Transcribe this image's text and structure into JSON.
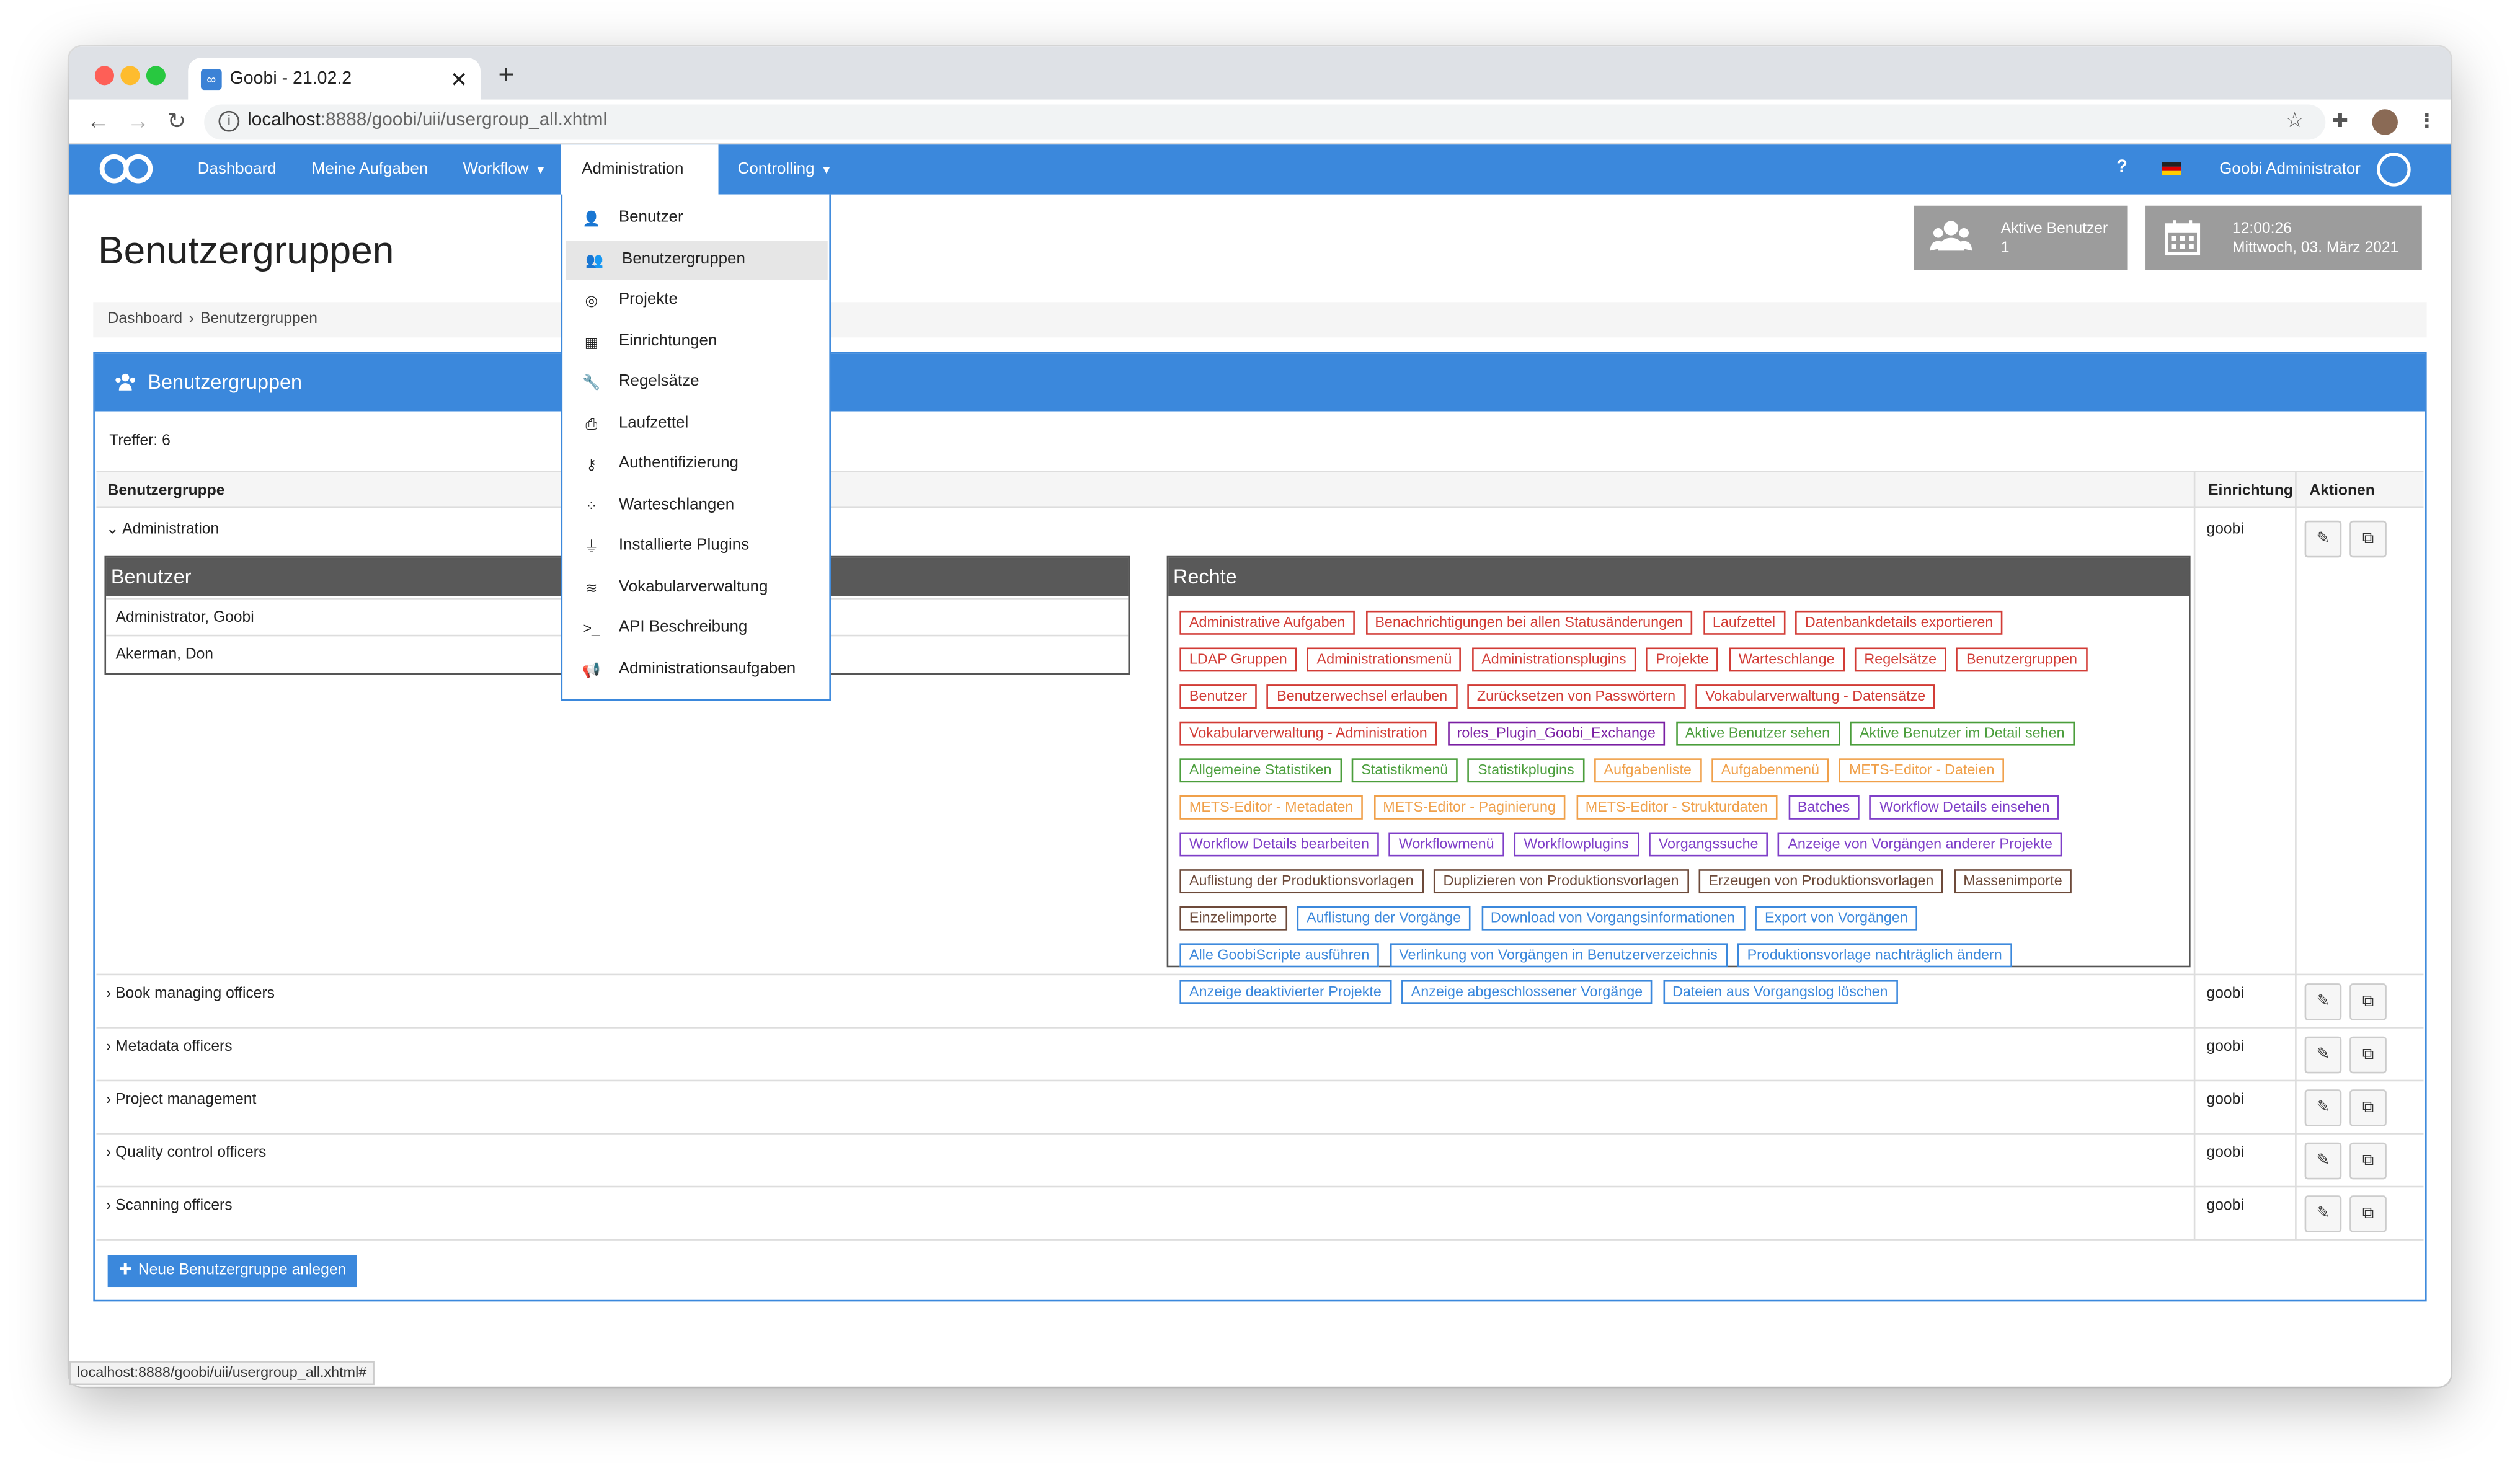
{
  "browser": {
    "tab_title": "Goobi - 21.02.2",
    "url_host": "localhost",
    "url_rest": ":8888/goobi/uii/usergroup_all.xhtml",
    "status_url": "localhost:8888/goobi/uii/usergroup_all.xhtml#"
  },
  "nav": {
    "dashboard": "Dashboard",
    "tasks": "Meine Aufgaben",
    "workflow": "Workflow",
    "administration": "Administration",
    "controlling": "Controlling",
    "help": "?",
    "user": "Goobi Administrator"
  },
  "admin_menu": [
    {
      "icon": "user-icon",
      "glyph": "👤",
      "label": "Benutzer"
    },
    {
      "icon": "users-icon",
      "glyph": "👥",
      "label": "Benutzergruppen"
    },
    {
      "icon": "projects-icon",
      "glyph": "◎",
      "label": "Projekte"
    },
    {
      "icon": "building-icon",
      "glyph": "▦",
      "label": "Einrichtungen"
    },
    {
      "icon": "wrench-icon",
      "glyph": "🔧",
      "label": "Regelsätze"
    },
    {
      "icon": "print-icon",
      "glyph": "⎙",
      "label": "Laufzettel"
    },
    {
      "icon": "key-icon",
      "glyph": "⚷",
      "label": "Authentifizierung"
    },
    {
      "icon": "spinner-icon",
      "glyph": "⁘",
      "label": "Warteschlangen"
    },
    {
      "icon": "plug-icon",
      "glyph": "⏚",
      "label": "Installierte Plugins"
    },
    {
      "icon": "database-icon",
      "glyph": "≋",
      "label": "Vokabularverwaltung"
    },
    {
      "icon": "terminal-icon",
      "glyph": ">_",
      "label": "API Beschreibung"
    },
    {
      "icon": "bullhorn-icon",
      "glyph": "📢",
      "label": "Administrationsaufgaben"
    }
  ],
  "page": {
    "title": "Benutzergruppen",
    "breadcrumb": [
      "Dashboard",
      "Benutzergruppen"
    ],
    "widgets": {
      "active_users_label": "Aktive Benutzer",
      "active_users_count": "1",
      "time": "12:00:26",
      "date": "Mittwoch, 03. März 2021"
    }
  },
  "panel": {
    "title": "Benutzergruppen",
    "hits": "Treffer: 6",
    "columns": [
      "Benutzergruppe",
      "Einrichtung",
      "Aktionen"
    ],
    "groups": [
      {
        "name": "Administration",
        "institution": "goobi"
      },
      {
        "name": "Book managing officers",
        "institution": "goobi"
      },
      {
        "name": "Metadata officers",
        "institution": "goobi"
      },
      {
        "name": "Project management",
        "institution": "goobi"
      },
      {
        "name": "Quality control officers",
        "institution": "goobi"
      },
      {
        "name": "Scanning officers",
        "institution": "goobi"
      }
    ],
    "users_box": {
      "title": "Benutzer",
      "users": [
        "Administrator, Goobi",
        "Akerman, Don"
      ]
    },
    "rights_box": {
      "title": "Rechte",
      "rights": [
        {
          "label": "Administrative Aufgaben",
          "color": "#d23c36"
        },
        {
          "label": "Benachrichtigungen bei allen Statusänderungen",
          "color": "#d23c36"
        },
        {
          "label": "Laufzettel",
          "color": "#d23c36"
        },
        {
          "label": "Datenbankdetails exportieren",
          "color": "#d23c36"
        },
        {
          "label": "LDAP Gruppen",
          "color": "#d23c36"
        },
        {
          "label": "Administrationsmenü",
          "color": "#d23c36"
        },
        {
          "label": "Administrationsplugins",
          "color": "#d23c36"
        },
        {
          "label": "Projekte",
          "color": "#d23c36"
        },
        {
          "label": "Warteschlange",
          "color": "#d23c36"
        },
        {
          "label": "Regelsätze",
          "color": "#d23c36"
        },
        {
          "label": "Benutzergruppen",
          "color": "#d23c36"
        },
        {
          "label": "Benutzer",
          "color": "#d23c36"
        },
        {
          "label": "Benutzerwechsel erlauben",
          "color": "#d23c36"
        },
        {
          "label": "Zurücksetzen von Passwörtern",
          "color": "#d23c36"
        },
        {
          "label": "Vokabularverwaltung - Datensätze",
          "color": "#d23c36"
        },
        {
          "label": "Vokabularverwaltung - Administration",
          "color": "#d23c36"
        },
        {
          "label": "roles_Plugin_Goobi_Exchange",
          "color": "#7a1fa3"
        },
        {
          "label": "Aktive Benutzer sehen",
          "color": "#4b9e3c"
        },
        {
          "label": "Aktive Benutzer im Detail sehen",
          "color": "#4b9e3c"
        },
        {
          "label": "Allgemeine Statistiken",
          "color": "#4b9e3c"
        },
        {
          "label": "Statistikmenü",
          "color": "#4b9e3c"
        },
        {
          "label": "Statistikplugins",
          "color": "#4b9e3c"
        },
        {
          "label": "Aufgabenliste",
          "color": "#f0a04a"
        },
        {
          "label": "Aufgabenmenü",
          "color": "#f0a04a"
        },
        {
          "label": "METS-Editor - Dateien",
          "color": "#f0a04a"
        },
        {
          "label": "METS-Editor - Metadaten",
          "color": "#f0a04a"
        },
        {
          "label": "METS-Editor - Paginierung",
          "color": "#f0a04a"
        },
        {
          "label": "METS-Editor - Strukturdaten",
          "color": "#f0a04a"
        },
        {
          "label": "Batches",
          "color": "#7f3fc8"
        },
        {
          "label": "Workflow Details einsehen",
          "color": "#7f3fc8"
        },
        {
          "label": "Workflow Details bearbeiten",
          "color": "#7f3fc8"
        },
        {
          "label": "Workflowmenü",
          "color": "#7f3fc8"
        },
        {
          "label": "Workflowplugins",
          "color": "#7f3fc8"
        },
        {
          "label": "Vorgangssuche",
          "color": "#7f3fc8"
        },
        {
          "label": "Anzeige von Vorgängen anderer Projekte",
          "color": "#7f3fc8"
        },
        {
          "label": "Auflistung der Produktionsvorlagen",
          "color": "#6d4a3a"
        },
        {
          "label": "Duplizieren von Produktionsvorlagen",
          "color": "#6d4a3a"
        },
        {
          "label": "Erzeugen von Produktionsvorlagen",
          "color": "#6d4a3a"
        },
        {
          "label": "Massenimporte",
          "color": "#6d4a3a"
        },
        {
          "label": "Einzelimporte",
          "color": "#6d4a3a"
        },
        {
          "label": "Auflistung der Vorgänge",
          "color": "#3b88dc"
        },
        {
          "label": "Download von Vorgangsinformationen",
          "color": "#3b88dc"
        },
        {
          "label": "Export von Vorgängen",
          "color": "#3b88dc"
        },
        {
          "label": "Alle GoobiScripte ausführen",
          "color": "#3b88dc"
        },
        {
          "label": "Verlinkung von Vorgängen in Benutzerverzeichnis",
          "color": "#3b88dc"
        },
        {
          "label": "Produktionsvorlage nachträglich ändern",
          "color": "#3b88dc"
        },
        {
          "label": "Anzeige deaktivierter Projekte",
          "color": "#3b88dc"
        },
        {
          "label": "Anzeige abgeschlossener Vorgänge",
          "color": "#3b88dc"
        },
        {
          "label": "Dateien aus Vorgangslog löschen",
          "color": "#3b88dc"
        }
      ]
    },
    "new_button": "Neue Benutzergruppe anlegen"
  },
  "colors": {
    "accent": "#3b88dc",
    "widget": "#9c9c9c",
    "sub_header": "#595959"
  }
}
